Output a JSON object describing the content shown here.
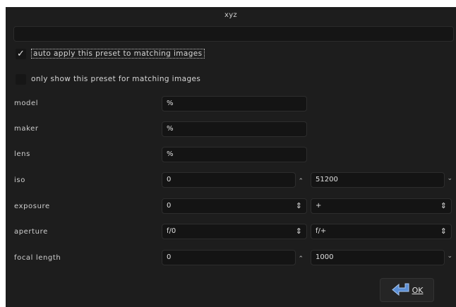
{
  "dialog": {
    "title": "xyz",
    "name_value": ""
  },
  "options": {
    "auto_apply": {
      "label": "auto apply this preset to matching images",
      "checked": true,
      "check_glyph": "✓"
    },
    "filter_only": {
      "label": "only show this preset for matching images",
      "checked": false,
      "check_glyph": ""
    }
  },
  "rows": {
    "model": {
      "label": "model",
      "value": "%"
    },
    "maker": {
      "label": "maker",
      "value": "%"
    },
    "lens": {
      "label": "lens",
      "value": "%"
    },
    "iso": {
      "label": "iso",
      "min": "0",
      "max": "51200"
    },
    "exposure": {
      "label": "exposure",
      "min": "0",
      "max": "+"
    },
    "aperture": {
      "label": "aperture",
      "min": "f/0",
      "max": "f/+"
    },
    "focal_length": {
      "label": "focal length",
      "min": "0",
      "max": "1000"
    }
  },
  "buttons": {
    "ok_label": "OK",
    "ok_icon": "return-arrow-icon"
  },
  "colors": {
    "background": "#1d1d1d",
    "field": "#141414",
    "text": "#d0d0d0",
    "ok_icon": "#5b8fd6"
  }
}
